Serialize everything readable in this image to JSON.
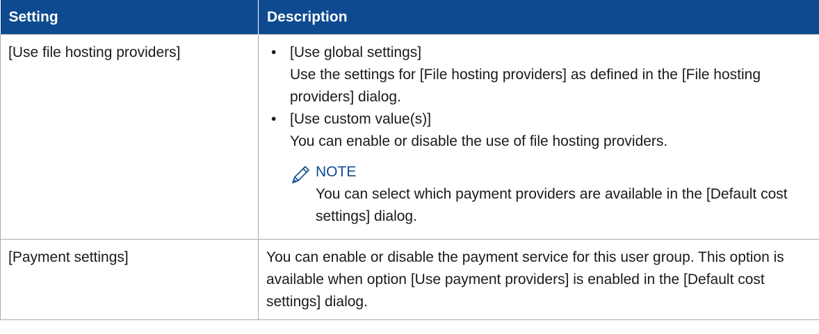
{
  "header": {
    "col1": "Setting",
    "col2": "Description"
  },
  "rows": [
    {
      "setting": "[Use file hosting providers]",
      "options": [
        {
          "bullet": "•",
          "title": "[Use global settings]",
          "text": "Use the settings for [File hosting providers] as defined in the [File hosting providers] dialog."
        },
        {
          "bullet": "•",
          "title": "[Use custom value(s)]",
          "text": "You can enable or disable the use of file hosting providers."
        }
      ],
      "note": {
        "icon": "pencil-note-icon",
        "title": "NOTE",
        "text": "You can select which payment providers are available in the [Default cost settings] dialog."
      }
    },
    {
      "setting": "[Payment settings]",
      "description": "You can enable or disable the payment service for this user group. This option is available when option [Use payment providers] is enabled in the [Default cost settings] dialog."
    }
  ],
  "colors": {
    "header_bg": "#0d4a8f",
    "header_text": "#ffffff",
    "note_title": "#0d4a8f",
    "border": "#a9a9a9"
  }
}
